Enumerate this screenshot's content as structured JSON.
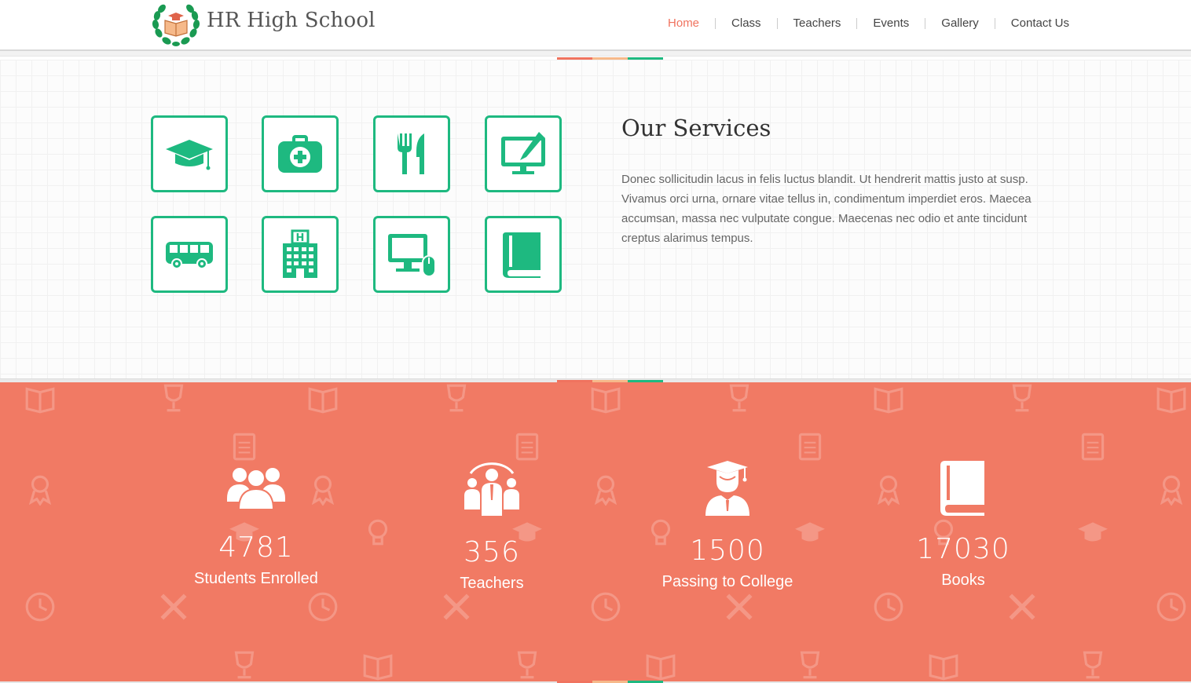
{
  "header": {
    "brand": "HR High School",
    "nav": [
      {
        "label": "Home",
        "active": true
      },
      {
        "label": "Class",
        "active": false
      },
      {
        "label": "Teachers",
        "active": false
      },
      {
        "label": "Events",
        "active": false
      },
      {
        "label": "Gallery",
        "active": false
      },
      {
        "label": "Contact Us",
        "active": false
      }
    ]
  },
  "colors": {
    "accent": "#f0735f",
    "green": "#1eb980",
    "coral": "#f17a64",
    "peach": "#f6b98a"
  },
  "services": {
    "title": "Our Services",
    "text": "Donec sollicitudin lacus in felis luctus blandit. Ut hendrerit mattis justo at susp. Vivamus orci urna, ornare vitae tellus in, condimentum imperdiet eros. Maecea accumsan, massa nec vulputate congue. Maecenas nec odio et ante tincidunt creptus alarimus tempus.",
    "icons": [
      "graduation-cap-icon",
      "medical-kit-icon",
      "cutlery-icon",
      "drawing-monitor-icon",
      "bus-icon",
      "hospital-icon",
      "computer-mouse-icon",
      "book-icon"
    ]
  },
  "stats": [
    {
      "icon": "students-group-icon",
      "value": "4781",
      "label": "Students Enrolled"
    },
    {
      "icon": "teachers-icon",
      "value": "356",
      "label": "Teachers"
    },
    {
      "icon": "graduate-icon",
      "value": "1500",
      "label": "Passing to College"
    },
    {
      "icon": "book-icon",
      "value": "17030",
      "label": "Books"
    }
  ]
}
